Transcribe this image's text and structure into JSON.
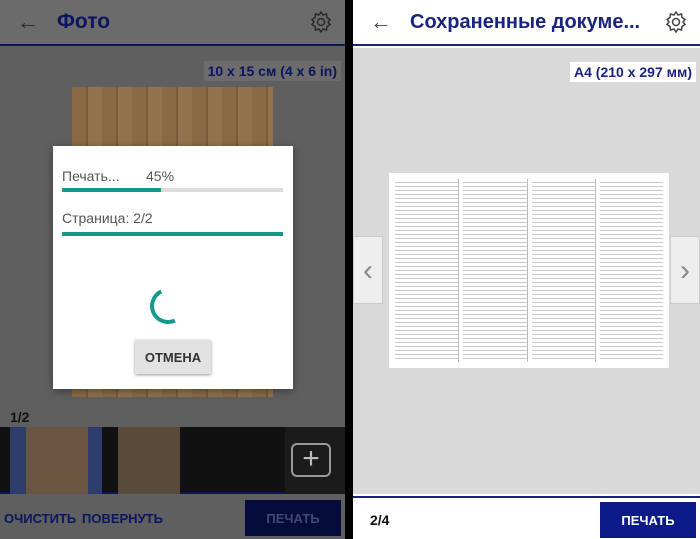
{
  "left": {
    "title": "Фото",
    "paper_size": "10 x 15 см (4 x 6 in)",
    "dialog": {
      "printing_label": "Печать...",
      "printing_percent": "45%",
      "progress": 0.45,
      "page_label": "Страница: 2/2",
      "page_progress": 1.0,
      "cancel": "ОТМЕНА"
    },
    "counter": "1/2",
    "clear": "ОЧИСТИТЬ",
    "rotate": "ПОВЕРНУТЬ",
    "print": "ПЕЧАТЬ"
  },
  "right": {
    "title": "Сохраненные докуме...",
    "paper_size": "A4 (210 x 297 мм)",
    "counter": "2/4",
    "print": "ПЕЧАТЬ"
  },
  "colors": {
    "accent": "#1a237e",
    "progress": "#139a8a"
  }
}
